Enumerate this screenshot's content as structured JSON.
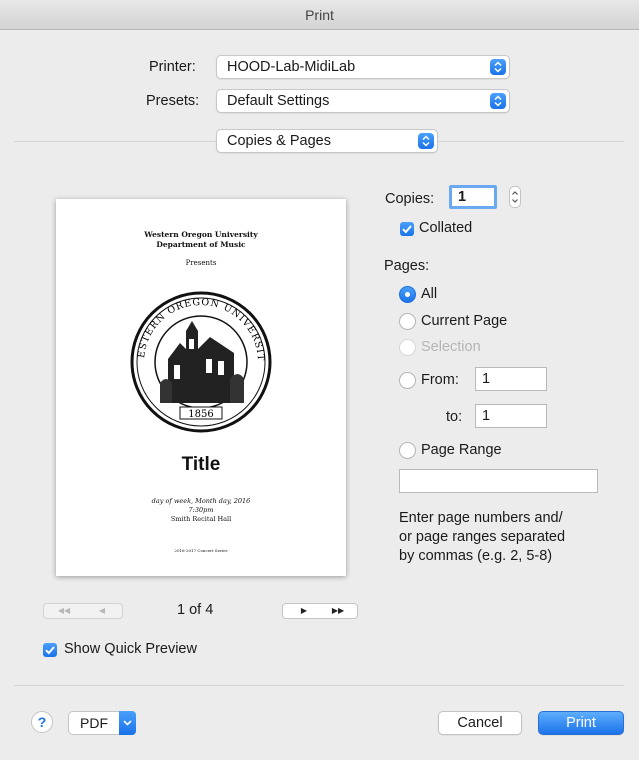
{
  "window": {
    "title": "Print"
  },
  "printer": {
    "label": "Printer:",
    "value": "HOOD-Lab-MidiLab"
  },
  "presets": {
    "label": "Presets:",
    "value": "Default Settings"
  },
  "section": {
    "value": "Copies & Pages"
  },
  "copies": {
    "label": "Copies:",
    "value": "1"
  },
  "collated": {
    "label": "Collated",
    "checked": true
  },
  "pages": {
    "label": "Pages:",
    "all": "All",
    "current": "Current Page",
    "selection": "Selection",
    "from_label": "From:",
    "from_value": "1",
    "to_label": "to:",
    "to_value": "1",
    "range_label": "Page Range",
    "range_value": "",
    "help_line1": "Enter page numbers and/",
    "help_line2": "or page ranges separated",
    "help_line3": "by commas (e.g. 2, 5-8)",
    "selected": "All"
  },
  "preview": {
    "line1": "Western Oregon University",
    "line2": "Department of Music",
    "presents": "Presents",
    "seal_year": "1856",
    "seal_top": "WESTERN OREGON UNIVERSITY",
    "title": "Title",
    "date": "day of week, Month day, 2016",
    "time": "7:30pm",
    "venue": "Smith Recital Hall",
    "footer": "2016-2017 Concert Series",
    "page_indicator": "1 of 4"
  },
  "show_quick_preview": {
    "label": "Show Quick Preview",
    "checked": true
  },
  "footer": {
    "help": "?",
    "pdf": "PDF",
    "cancel": "Cancel",
    "print": "Print"
  },
  "colors": {
    "accent": "#1a72ea",
    "window_bg": "#ececec"
  }
}
